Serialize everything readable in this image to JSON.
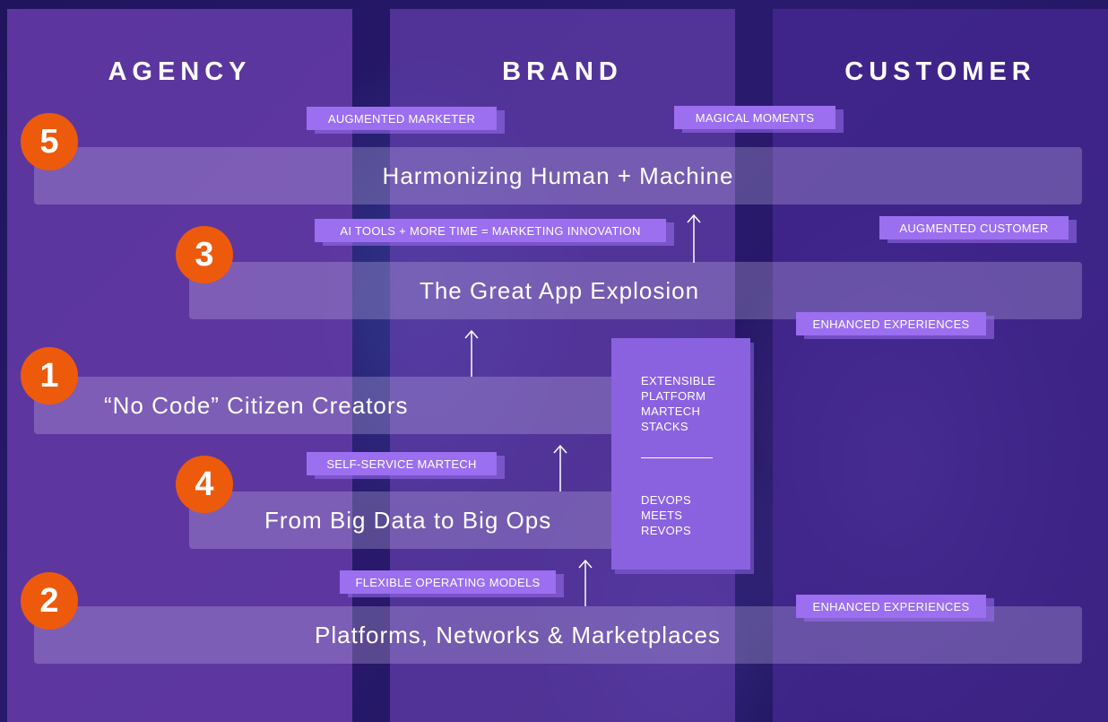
{
  "columns": [
    "AGENCY",
    "BRAND",
    "CUSTOMER"
  ],
  "bands": [
    {
      "number": "5",
      "label": "Harmonizing Human + Machine"
    },
    {
      "number": "3",
      "label": "The Great App Explosion"
    },
    {
      "number": "1",
      "label": "“No Code” Citizen Creators"
    },
    {
      "number": "4",
      "label": "From Big Data to Big Ops"
    },
    {
      "number": "2",
      "label": "Platforms, Networks & Marketplaces"
    }
  ],
  "tags": {
    "augmented_marketer": "AUGMENTED MARKETER",
    "magical_moments": "MAGICAL MOMENTS",
    "ai_tools": "AI TOOLS + MORE TIME = MARKETING INNOVATION",
    "augmented_customer": "AUGMENTED CUSTOMER",
    "enhanced_experiences_top": "ENHANCED EXPERIENCES",
    "self_service": "SELF-SERVICE MARTECH",
    "flexible_models": "FLEXIBLE OPERATING MODELS",
    "enhanced_experiences_bottom": "ENHANCED EXPERIENCES"
  },
  "side_box": {
    "top_text": "EXTENSIBLE\nPLATFORM\nMARTECH\nSTACKS",
    "bottom_text": "DEVOPS\nMEETS\nREVOPS"
  },
  "colors": {
    "badge": "#ee5a0c",
    "tag": "#9b6ff0",
    "agency_column": "#623aa4",
    "background": "#1c1257"
  }
}
